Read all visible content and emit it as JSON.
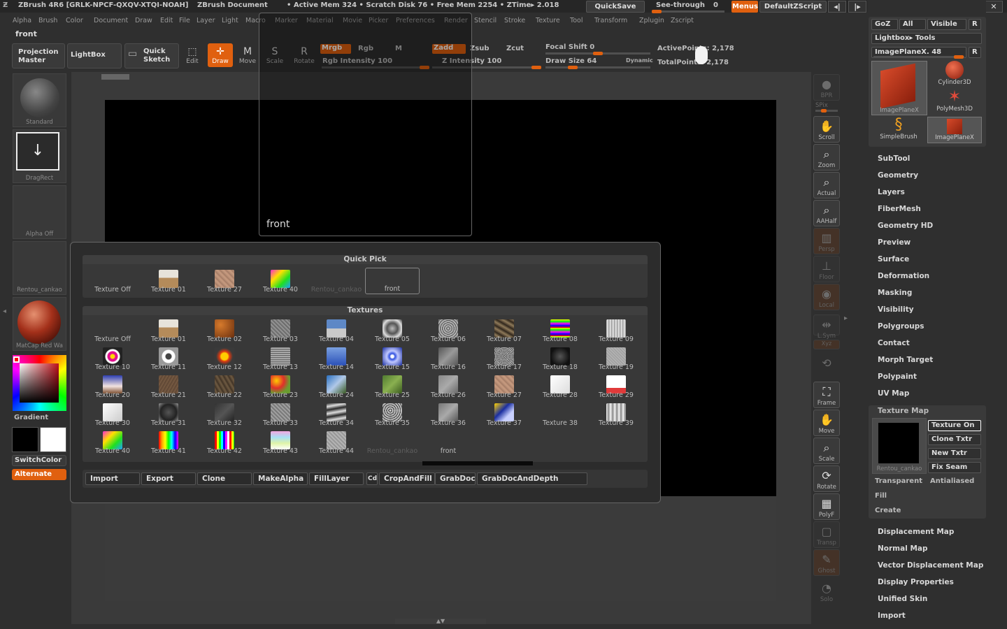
{
  "title": {
    "app": "ZBrush 4R6 [GRLK-NPCF-QXQV-XTQI-NOAH]",
    "doc": "ZBrush Document",
    "stats": "• Active Mem 324 • Scratch Disk 76 • Free Mem 2254 • ZTime▸ 2.018",
    "quicksave": "QuickSave",
    "seethrough": "See-through",
    "seethrough_value": "0",
    "menus": "Menus",
    "script": "DefaultZScript"
  },
  "menu": [
    "Alpha",
    "Brush",
    "Color",
    "Document",
    "Draw",
    "Edit",
    "File",
    "Layer",
    "Light",
    "Macro",
    "Marker",
    "Material",
    "Movie",
    "Picker",
    "Preferences",
    "Render",
    "Stencil",
    "Stroke",
    "Texture",
    "Tool",
    "Transform",
    "Zplugin",
    "Zscript"
  ],
  "document_name": "front",
  "toolbar": {
    "projection_master": "Projection Master",
    "lightbox": "LightBox",
    "quick_sketch": "Quick Sketch",
    "edit": "Edit",
    "draw": "Draw",
    "move": "Move",
    "scale": "Scale",
    "rotate": "Rotate",
    "mrgb": "Mrgb",
    "rgb": "Rgb",
    "m": "M",
    "zadd": "Zadd",
    "zsub": "Zsub",
    "zcut": "Zcut",
    "rgb_intensity": "Rgb Intensity 100",
    "z_intensity": "Z Intensity 100",
    "focal_shift": "Focal Shift 0",
    "draw_size": "Draw Size 64",
    "dynamic": "Dynamic",
    "active_points": "ActivePoints: 2,178",
    "total_points": "TotalPoints: 2,178"
  },
  "left": {
    "brush": "Standard",
    "stroke": "DragRect",
    "alpha": "Alpha Off",
    "texture": "Rentou_cankao",
    "material": "MatCap Red Wa",
    "gradient": "Gradient",
    "switchcolor": "SwitchColor",
    "alternate": "Alternate"
  },
  "canvas": {
    "front_label": "front"
  },
  "shelf": [
    "BPR",
    "SPix",
    "Scroll",
    "Zoom",
    "Actual",
    "AAHalf",
    "Persp",
    "Floor",
    "Local",
    "L.Sym",
    "Xyz",
    "Frame",
    "Move",
    "Scale",
    "Rotate",
    "PolyF",
    "Transp",
    "Ghost",
    "Solo"
  ],
  "popup": {
    "quick_pick": "Quick Pick",
    "textures": "Textures",
    "quick_items": [
      {
        "label": "Texture Off",
        "icon": "none"
      },
      {
        "label": "Texture 01",
        "icon": "beach"
      },
      {
        "label": "Texture 27",
        "icon": "skin"
      },
      {
        "label": "Texture 40",
        "icon": "spectrum"
      },
      {
        "label": "Rentou_cankao",
        "icon": "none",
        "dim": true
      },
      {
        "label": "front",
        "icon": "none",
        "sel": true
      }
    ],
    "items": [
      "Texture Off",
      "Texture 01",
      "Texture 02",
      "Texture 03",
      "Texture 04",
      "Texture 05",
      "Texture 06",
      "Texture 07",
      "Texture 08",
      "Texture 09",
      "Texture 10",
      "Texture 11",
      "Texture 12",
      "Texture 13",
      "Texture 14",
      "Texture 15",
      "Texture 16",
      "Texture 17",
      "Texture 18",
      "Texture 19",
      "Texture 20",
      "Texture 21",
      "Texture 22",
      "Texture 23",
      "Texture 24",
      "Texture 25",
      "Texture 26",
      "Texture 27",
      "Texture 28",
      "Texture 29",
      "Texture 30",
      "Texture 31",
      "Texture 32",
      "Texture 33",
      "Texture 34",
      "Texture 35",
      "Texture 36",
      "Texture 37",
      "Texture 38",
      "Texture 39",
      "Texture 40",
      "Texture 41",
      "Texture 42",
      "Texture 43",
      "Texture 44",
      "Rentou_cankao",
      "front"
    ],
    "buttons": [
      "Import",
      "Export",
      "Clone",
      "MakeAlpha",
      "FillLayer",
      "Cd",
      "CropAndFill",
      "GrabDoc",
      "GrabDocAndDepth"
    ]
  },
  "right": {
    "goz": "GoZ",
    "all": "All",
    "visible": "Visible",
    "r": "R",
    "lightbox_tools": "Lightbox▸ Tools",
    "imageplane": "ImagePlaneX. 48",
    "tools": [
      "ImagePlaneX",
      "Cylinder3D",
      "PolyMesh3D",
      "SimpleBrush",
      "ImagePlaneX"
    ],
    "sections_top": [
      "SubTool",
      "Geometry",
      "Layers",
      "FiberMesh",
      "Geometry HD",
      "Preview",
      "Surface",
      "Deformation",
      "Masking",
      "Visibility",
      "Polygroups",
      "Contact",
      "Morph Target",
      "Polypaint",
      "UV Map"
    ],
    "texture_map": "Texture Map",
    "texture_on": "Texture On",
    "clone_txtr": "Clone Txtr",
    "new_txtr": "New Txtr",
    "fix_seam": "Fix Seam",
    "tex_name": "Rentou_cankao",
    "transparent": "Transparent",
    "antialiased": "Antialiased",
    "fill": "Fill",
    "create": "Create",
    "sections_bottom": [
      "Displacement Map",
      "Normal Map",
      "Vector Displacement Map",
      "Display Properties",
      "Unified Skin",
      "Import"
    ]
  }
}
